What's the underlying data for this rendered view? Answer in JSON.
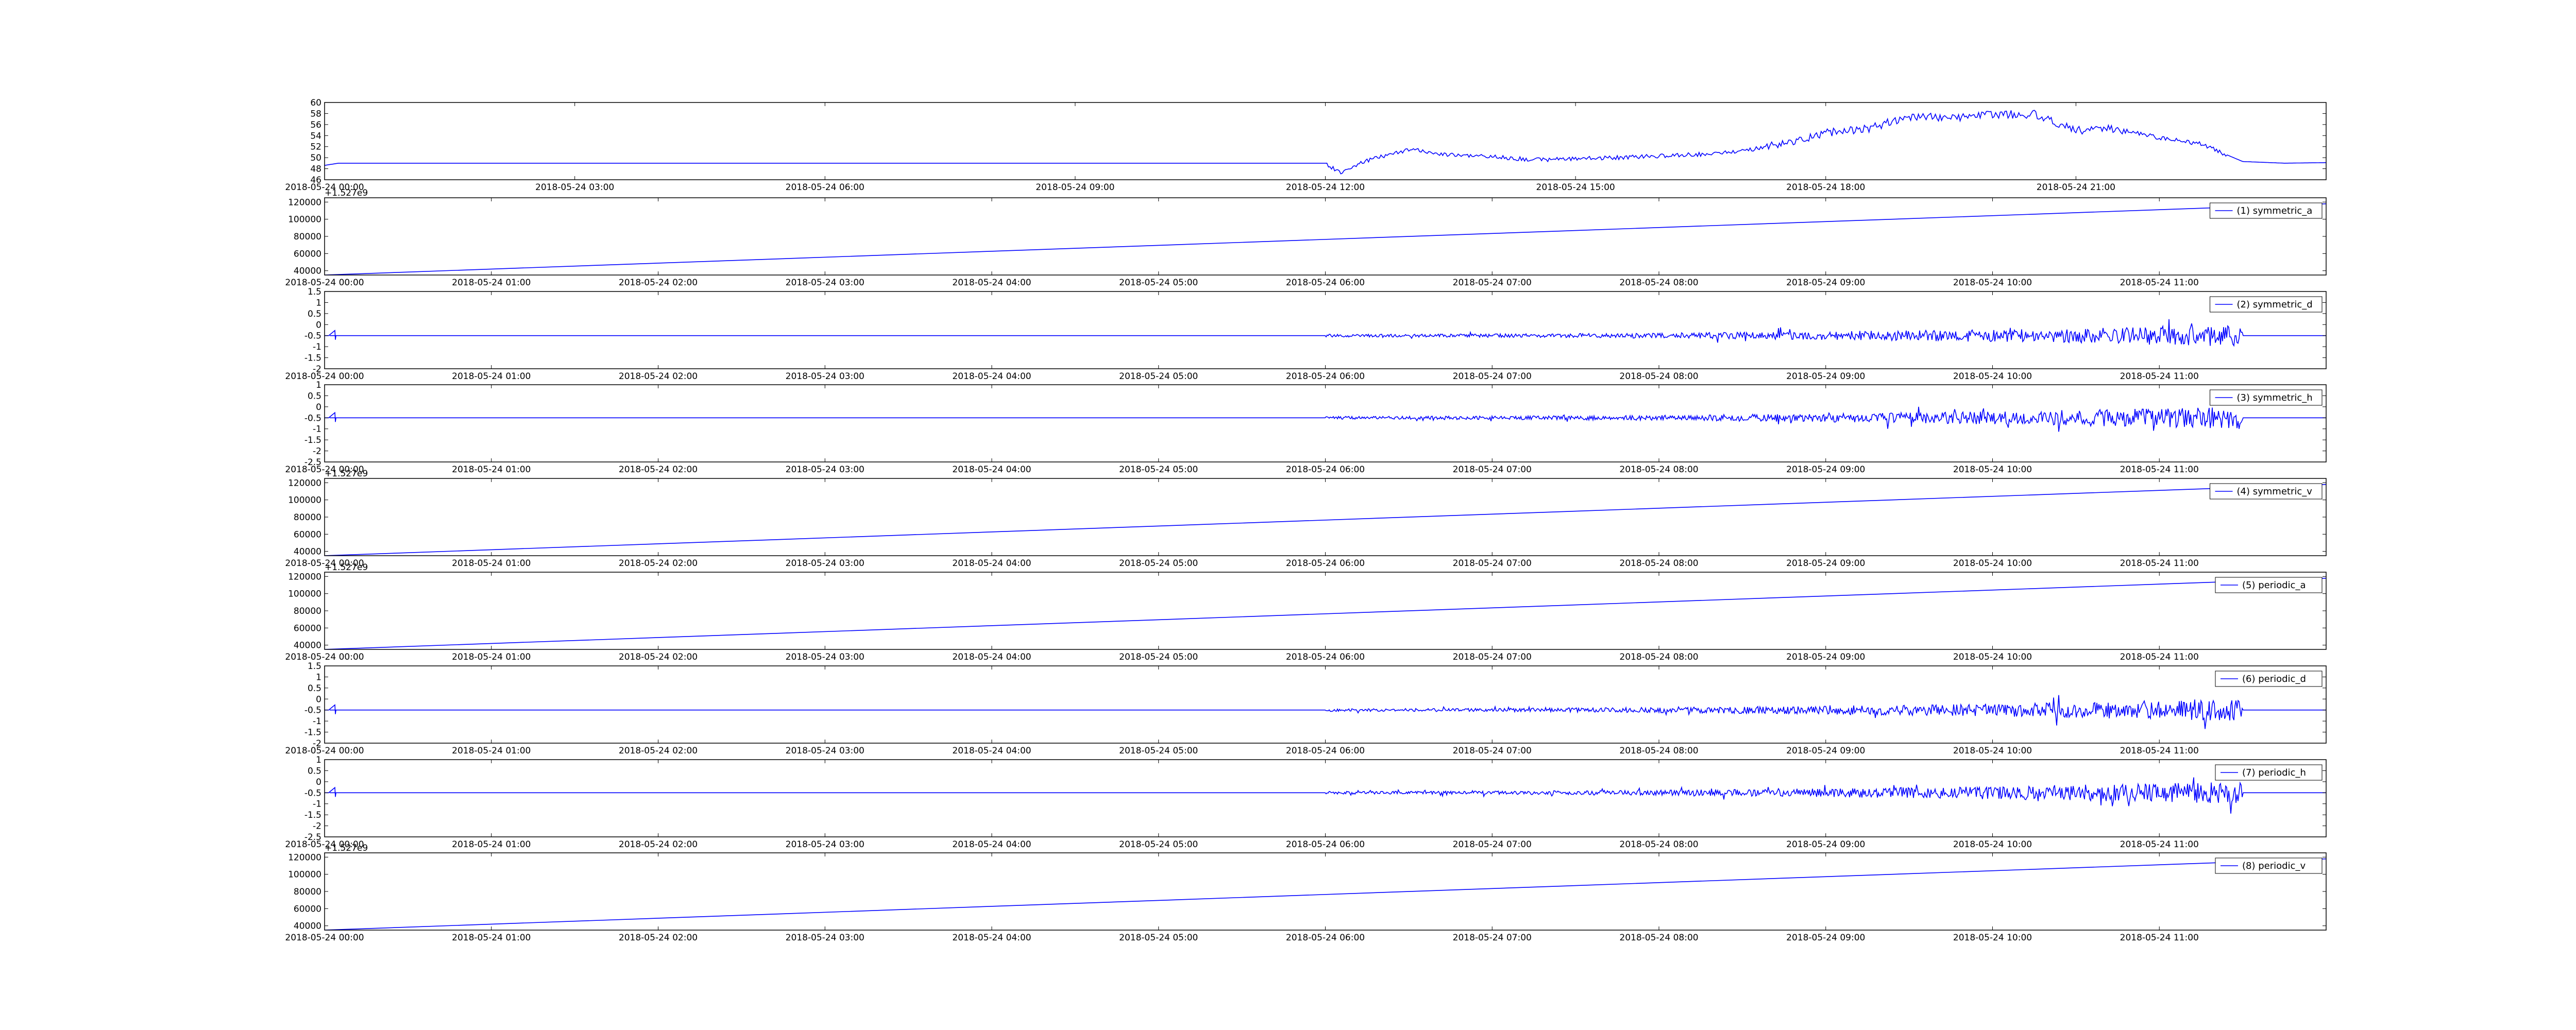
{
  "colors": {
    "line": "#0000ff",
    "axes": "#000000",
    "background": "#ffffff"
  },
  "chart_data": [
    {
      "type": "line",
      "title": "",
      "xlabel": "",
      "ylabel": "",
      "grid": false,
      "xlim": [
        "2018-05-24 00:00",
        "2018-05-25 00:00"
      ],
      "ylim": [
        46,
        60
      ],
      "yticks": [
        46,
        48,
        50,
        52,
        54,
        56,
        58,
        60
      ],
      "xticks": [
        "2018-05-24 00:00",
        "2018-05-24 03:00",
        "2018-05-24 06:00",
        "2018-05-24 09:00",
        "2018-05-24 12:00",
        "2018-05-24 15:00",
        "2018-05-24 18:00",
        "2018-05-24 21:00"
      ],
      "series": [
        {
          "x": [
            "2018-05-24 00:00",
            "2018-05-24 00:10",
            "2018-05-24 02:00",
            "2018-05-24 06:00",
            "2018-05-24 10:00",
            "2018-05-24 12:00",
            "2018-05-24 12:10",
            "2018-05-24 12:30",
            "2018-05-24 13:00",
            "2018-05-24 13:30",
            "2018-05-24 14:00",
            "2018-05-24 14:30",
            "2018-05-24 15:00",
            "2018-05-24 15:30",
            "2018-05-24 16:00",
            "2018-05-24 16:30",
            "2018-05-24 17:00",
            "2018-05-24 17:30",
            "2018-05-24 18:00",
            "2018-05-24 18:30",
            "2018-05-24 19:00",
            "2018-05-24 19:30",
            "2018-05-24 20:00",
            "2018-05-24 20:30",
            "2018-05-24 21:00",
            "2018-05-24 21:30",
            "2018-05-24 22:00",
            "2018-05-24 22:30",
            "2018-05-24 23:00",
            "2018-05-24 23:30",
            "2018-05-25 00:00"
          ],
          "values": [
            48.6,
            49.0,
            49.0,
            49.0,
            49.0,
            49.0,
            47.3,
            49.5,
            51.5,
            50.5,
            50.2,
            49.6,
            49.8,
            50.0,
            50.3,
            50.6,
            51.2,
            52.5,
            54.5,
            55.2,
            57.5,
            57.2,
            57.8,
            57.9,
            55.0,
            55.2,
            53.6,
            52.5,
            49.3,
            49.0,
            49.1
          ]
        }
      ]
    },
    {
      "type": "line",
      "offset_label": "+1.527e9",
      "xlim": [
        "2018-05-24 00:00",
        "2018-05-24 12:00"
      ],
      "ylim": [
        35000,
        125000
      ],
      "yticks": [
        40000,
        60000,
        80000,
        100000,
        120000
      ],
      "xticks": [
        "2018-05-24 00:00",
        "2018-05-24 01:00",
        "2018-05-24 02:00",
        "2018-05-24 03:00",
        "2018-05-24 04:00",
        "2018-05-24 05:00",
        "2018-05-24 06:00",
        "2018-05-24 07:00",
        "2018-05-24 08:00",
        "2018-05-24 09:00",
        "2018-05-24 10:00",
        "2018-05-24 11:00"
      ],
      "legend_position": "top-right",
      "series": [
        {
          "name": "(1) symmetric_a",
          "x": [
            "2018-05-24 00:00",
            "2018-05-24 12:00"
          ],
          "values": [
            35000,
            118000
          ]
        }
      ]
    },
    {
      "type": "line",
      "xlim": [
        "2018-05-24 00:00",
        "2018-05-24 12:00"
      ],
      "ylim": [
        -2.0,
        1.5
      ],
      "yticks": [
        -2.0,
        -1.5,
        -1.0,
        -0.5,
        0.0,
        0.5,
        1.0,
        1.5
      ],
      "xticks": [
        "2018-05-24 00:00",
        "2018-05-24 01:00",
        "2018-05-24 02:00",
        "2018-05-24 03:00",
        "2018-05-24 04:00",
        "2018-05-24 05:00",
        "2018-05-24 06:00",
        "2018-05-24 07:00",
        "2018-05-24 08:00",
        "2018-05-24 09:00",
        "2018-05-24 10:00",
        "2018-05-24 11:00"
      ],
      "legend_position": "top-right",
      "series": [
        {
          "name": "(2) symmetric_d",
          "baseline": -0.5,
          "noise_from": "2018-05-24 06:00",
          "noise_to": "2018-05-24 11:30",
          "peak_amplitude": 1.6
        }
      ]
    },
    {
      "type": "line",
      "xlim": [
        "2018-05-24 00:00",
        "2018-05-24 12:00"
      ],
      "ylim": [
        -2.5,
        1.0
      ],
      "yticks": [
        -2.5,
        -2.0,
        -1.5,
        -1.0,
        -0.5,
        0.0,
        0.5,
        1.0
      ],
      "xticks": [
        "2018-05-24 00:00",
        "2018-05-24 01:00",
        "2018-05-24 02:00",
        "2018-05-24 03:00",
        "2018-05-24 04:00",
        "2018-05-24 05:00",
        "2018-05-24 06:00",
        "2018-05-24 07:00",
        "2018-05-24 08:00",
        "2018-05-24 09:00",
        "2018-05-24 10:00",
        "2018-05-24 11:00"
      ],
      "legend_position": "top-right",
      "series": [
        {
          "name": "(3) symmetric_h",
          "baseline": -0.5,
          "noise_from": "2018-05-24 06:00",
          "noise_to": "2018-05-24 11:30",
          "peak_amplitude": 1.6
        }
      ]
    },
    {
      "type": "line",
      "offset_label": "+1.527e9",
      "xlim": [
        "2018-05-24 00:00",
        "2018-05-24 12:00"
      ],
      "ylim": [
        35000,
        125000
      ],
      "yticks": [
        40000,
        60000,
        80000,
        100000,
        120000
      ],
      "xticks": [
        "2018-05-24 00:00",
        "2018-05-24 01:00",
        "2018-05-24 02:00",
        "2018-05-24 03:00",
        "2018-05-24 04:00",
        "2018-05-24 05:00",
        "2018-05-24 06:00",
        "2018-05-24 07:00",
        "2018-05-24 08:00",
        "2018-05-24 09:00",
        "2018-05-24 10:00",
        "2018-05-24 11:00"
      ],
      "legend_position": "top-right",
      "series": [
        {
          "name": "(4) symmetric_v",
          "x": [
            "2018-05-24 00:00",
            "2018-05-24 12:00"
          ],
          "values": [
            35000,
            118000
          ]
        }
      ]
    },
    {
      "type": "line",
      "offset_label": "+1.527e9",
      "xlim": [
        "2018-05-24 00:00",
        "2018-05-24 12:00"
      ],
      "ylim": [
        35000,
        125000
      ],
      "yticks": [
        40000,
        60000,
        80000,
        100000,
        120000
      ],
      "xticks": [
        "2018-05-24 00:00",
        "2018-05-24 01:00",
        "2018-05-24 02:00",
        "2018-05-24 03:00",
        "2018-05-24 04:00",
        "2018-05-24 05:00",
        "2018-05-24 06:00",
        "2018-05-24 07:00",
        "2018-05-24 08:00",
        "2018-05-24 09:00",
        "2018-05-24 10:00",
        "2018-05-24 11:00"
      ],
      "legend_position": "top-right",
      "series": [
        {
          "name": "(5) periodic_a",
          "x": [
            "2018-05-24 00:00",
            "2018-05-24 12:00"
          ],
          "values": [
            35000,
            118000
          ]
        }
      ]
    },
    {
      "type": "line",
      "xlim": [
        "2018-05-24 00:00",
        "2018-05-24 12:00"
      ],
      "ylim": [
        -2.0,
        1.5
      ],
      "yticks": [
        -2.0,
        -1.5,
        -1.0,
        -0.5,
        0.0,
        0.5,
        1.0,
        1.5
      ],
      "xticks": [
        "2018-05-24 00:00",
        "2018-05-24 01:00",
        "2018-05-24 02:00",
        "2018-05-24 03:00",
        "2018-05-24 04:00",
        "2018-05-24 05:00",
        "2018-05-24 06:00",
        "2018-05-24 07:00",
        "2018-05-24 08:00",
        "2018-05-24 09:00",
        "2018-05-24 10:00",
        "2018-05-24 11:00"
      ],
      "legend_position": "top-right",
      "series": [
        {
          "name": "(6) periodic_d",
          "baseline": -0.5,
          "noise_from": "2018-05-24 06:00",
          "noise_to": "2018-05-24 11:30",
          "peak_amplitude": 1.6
        }
      ]
    },
    {
      "type": "line",
      "xlim": [
        "2018-05-24 00:00",
        "2018-05-24 12:00"
      ],
      "ylim": [
        -2.5,
        1.0
      ],
      "yticks": [
        -2.5,
        -2.0,
        -1.5,
        -1.0,
        -0.5,
        0.0,
        0.5,
        1.0
      ],
      "xticks": [
        "2018-05-24 00:00",
        "2018-05-24 01:00",
        "2018-05-24 02:00",
        "2018-05-24 03:00",
        "2018-05-24 04:00",
        "2018-05-24 05:00",
        "2018-05-24 06:00",
        "2018-05-24 07:00",
        "2018-05-24 08:00",
        "2018-05-24 09:00",
        "2018-05-24 10:00",
        "2018-05-24 11:00"
      ],
      "legend_position": "top-right",
      "series": [
        {
          "name": "(7) periodic_h",
          "baseline": -0.5,
          "noise_from": "2018-05-24 06:00",
          "noise_to": "2018-05-24 11:30",
          "peak_amplitude": 1.6
        }
      ]
    },
    {
      "type": "line",
      "offset_label": "+1.527e9",
      "xlim": [
        "2018-05-24 00:00",
        "2018-05-24 12:00"
      ],
      "ylim": [
        35000,
        125000
      ],
      "yticks": [
        40000,
        60000,
        80000,
        100000,
        120000
      ],
      "xticks": [
        "2018-05-24 00:00",
        "2018-05-24 01:00",
        "2018-05-24 02:00",
        "2018-05-24 03:00",
        "2018-05-24 04:00",
        "2018-05-24 05:00",
        "2018-05-24 06:00",
        "2018-05-24 07:00",
        "2018-05-24 08:00",
        "2018-05-24 09:00",
        "2018-05-24 10:00",
        "2018-05-24 11:00"
      ],
      "legend_position": "top-right",
      "series": [
        {
          "name": "(8) periodic_v",
          "x": [
            "2018-05-24 00:00",
            "2018-05-24 12:00"
          ],
          "values": [
            35000,
            118000
          ]
        }
      ]
    }
  ]
}
